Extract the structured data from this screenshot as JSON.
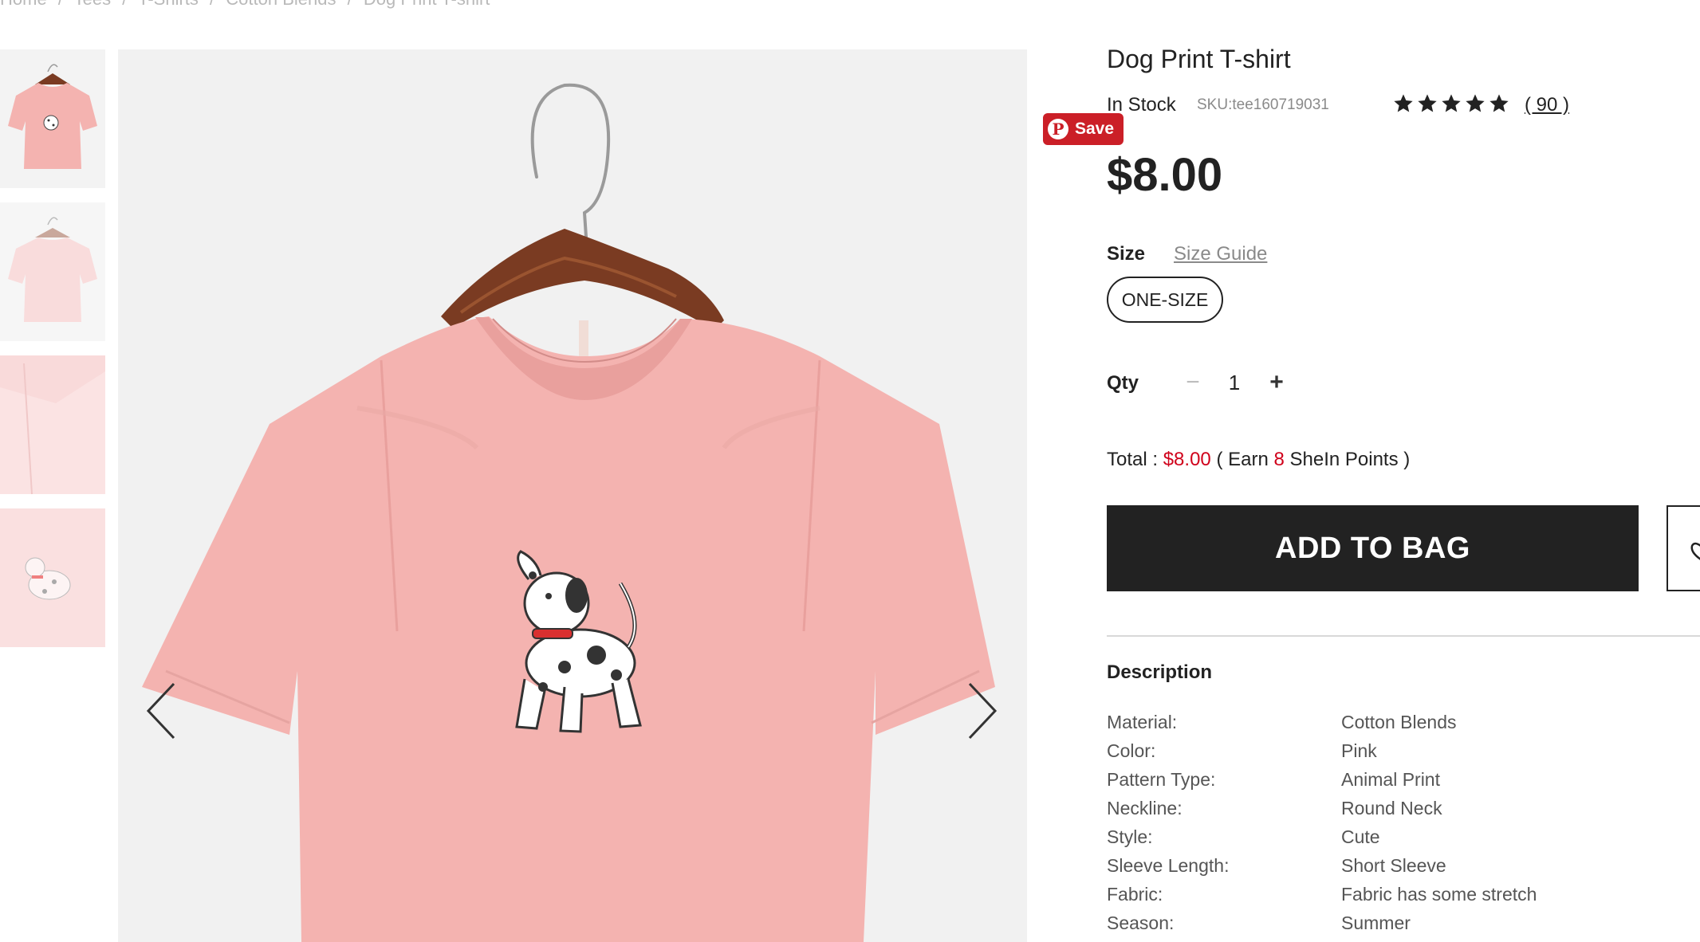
{
  "breadcrumb": [
    "Home",
    "/",
    "Tees",
    "/",
    "T-Shirts",
    "/",
    "Cotton Blends",
    "/",
    "Dog Print T-shirt"
  ],
  "thumbnails": [
    {
      "name": "thumb-front"
    },
    {
      "name": "thumb-back"
    },
    {
      "name": "thumb-sleeve-detail"
    },
    {
      "name": "thumb-print-detail"
    }
  ],
  "pin": {
    "label": "Save",
    "logo": "P"
  },
  "product": {
    "title": "Dog Print T-shirt",
    "stock": "In Stock",
    "sku": "SKU:tee160719031",
    "rating_stars": 5,
    "reviews": "( 90 )",
    "price": "$8.00"
  },
  "size": {
    "label": "Size",
    "guide": "Size Guide",
    "options": [
      "ONE-SIZE"
    ]
  },
  "qty": {
    "label": "Qty",
    "minus": "−",
    "value": "1",
    "plus": "+"
  },
  "total": {
    "label": "Total :",
    "amount": "$8.00",
    "earn_open": "( Earn",
    "points": "8",
    "points_suffix": "SheIn Points )"
  },
  "actions": {
    "add_to_bag": "ADD TO BAG"
  },
  "description": {
    "title": "Description",
    "rows": [
      {
        "key": "Material:",
        "value": "Cotton Blends"
      },
      {
        "key": "Color:",
        "value": "Pink"
      },
      {
        "key": "Pattern Type:",
        "value": "Animal Print"
      },
      {
        "key": "Neckline:",
        "value": "Round Neck"
      },
      {
        "key": "Style:",
        "value": "Cute"
      },
      {
        "key": "Sleeve Length:",
        "value": "Short Sleeve"
      },
      {
        "key": "Fabric:",
        "value": "Fabric has some stretch"
      },
      {
        "key": "Season:",
        "value": "Summer"
      }
    ]
  },
  "colors": {
    "shirt": "#f4b3b0",
    "shirt_shadow": "#e9a09d",
    "hanger_wood": "#7a3b22",
    "accent_red": "#d0021b",
    "pin_red": "#cb1f27",
    "button_dark": "#222222"
  },
  "icons": {
    "arrow_prev": "chevron-left-icon",
    "arrow_next": "chevron-right-icon",
    "star": "star-icon",
    "wishlist": "heart-icon"
  }
}
